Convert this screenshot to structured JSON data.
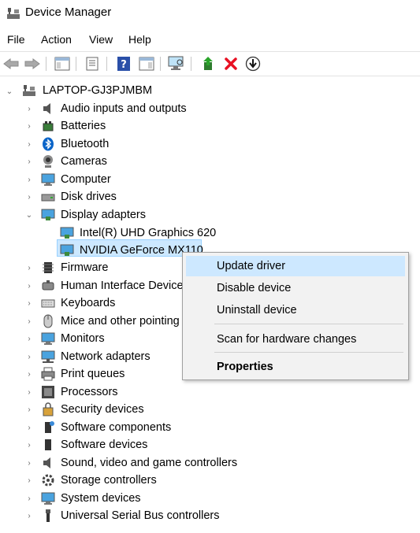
{
  "window": {
    "title": "Device Manager",
    "icon": "device-manager-icon"
  },
  "menu": {
    "items": [
      "File",
      "Action",
      "View",
      "Help"
    ]
  },
  "toolbar": {
    "buttons": [
      "back-arrow-icon",
      "forward-arrow-icon",
      "show-hide-console-tree-icon",
      "properties-icon",
      "help-icon",
      "action-pane-icon",
      "scan-hardware-icon",
      "update-driver-icon",
      "uninstall-icon",
      "disable-device-icon"
    ]
  },
  "tree": {
    "root": "LAPTOP-GJ3PJMBM",
    "categories": [
      "Audio inputs and outputs",
      "Batteries",
      "Bluetooth",
      "Cameras",
      "Computer",
      "Disk drives",
      "Display adapters",
      "Firmware",
      "Human Interface Device",
      "Keyboards",
      "Mice and other pointing",
      "Monitors",
      "Network adapters",
      "Print queues",
      "Processors",
      "Security devices",
      "Software components",
      "Software devices",
      "Sound, video and game controllers",
      "Storage controllers",
      "System devices",
      "Universal Serial Bus controllers"
    ],
    "display_children": [
      "Intel(R) UHD Graphics 620",
      "NVIDIA GeForce MX110"
    ]
  },
  "context_menu": {
    "items": [
      "Update driver",
      "Disable device",
      "Uninstall device",
      "Scan for hardware changes",
      "Properties"
    ]
  },
  "colors": {
    "selection": "#cce8ff",
    "selection_border": "#99d1ff",
    "menu_hover": "#cde8ff",
    "accent": "#0078d7",
    "delete_red": "#e81123"
  }
}
